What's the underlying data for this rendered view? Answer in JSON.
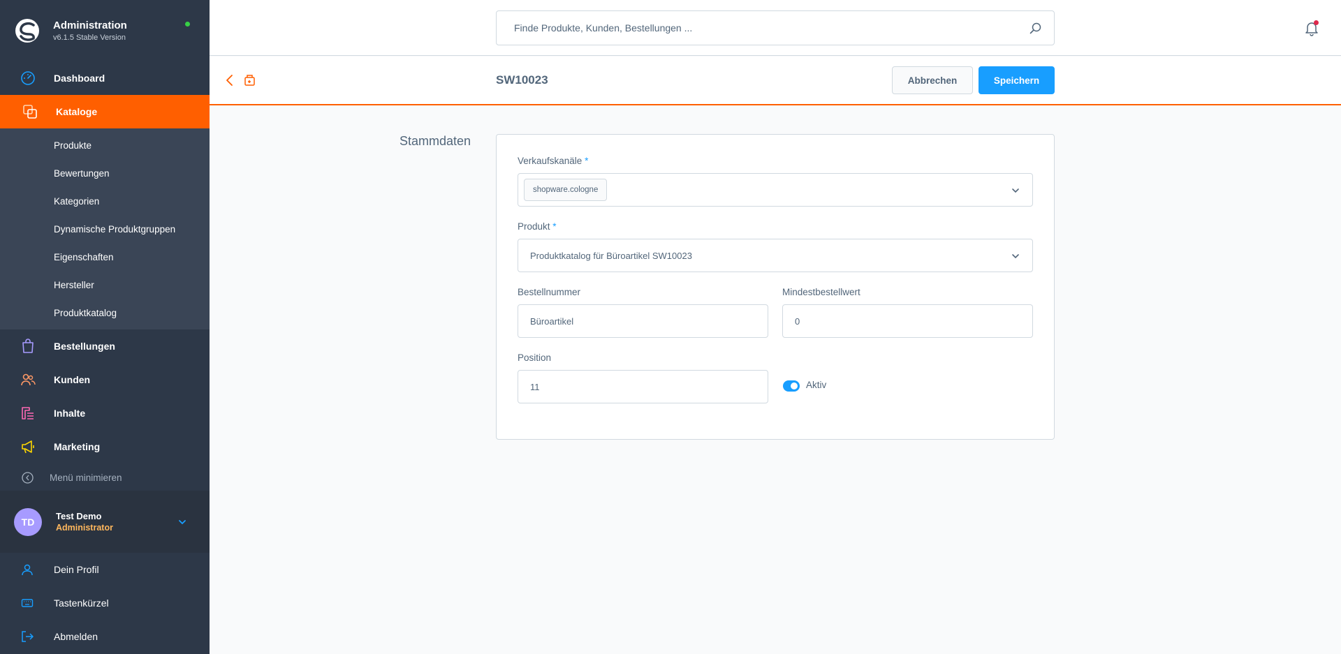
{
  "brand": {
    "title": "Administration",
    "version": "v6.1.5 Stable Version"
  },
  "sidebar": {
    "items": [
      {
        "label": "Dashboard",
        "icon": "dashboard-icon"
      },
      {
        "label": "Kataloge",
        "icon": "catalog-icon",
        "active": true
      },
      {
        "label": "Bestellungen",
        "icon": "orders-icon"
      },
      {
        "label": "Kunden",
        "icon": "customers-icon"
      },
      {
        "label": "Inhalte",
        "icon": "content-icon"
      },
      {
        "label": "Marketing",
        "icon": "marketing-icon"
      }
    ],
    "subitems": [
      "Produkte",
      "Bewertungen",
      "Kategorien",
      "Dynamische Produktgruppen",
      "Eigenschaften",
      "Hersteller",
      "Produktkatalog"
    ],
    "minimize_label": "Menü minimieren"
  },
  "user": {
    "initials": "TD",
    "name": "Test Demo",
    "role": "Administrator"
  },
  "account_nav": [
    "Dein Profil",
    "Tastenkürzel",
    "Abmelden"
  ],
  "search": {
    "placeholder": "Finde Produkte, Kunden, Bestellungen ..."
  },
  "smartbar": {
    "title": "SW10023",
    "cancel_label": "Abbrechen",
    "save_label": "Speichern"
  },
  "form": {
    "section_title": "Stammdaten",
    "sales_channels": {
      "label": "Verkaufskanäle",
      "required": "*",
      "tags": [
        "shopware.cologne"
      ]
    },
    "product": {
      "label": "Produkt",
      "required": "*",
      "value": "Produktkatalog für Büroartikel SW10023"
    },
    "order_number": {
      "label": "Bestellnummer",
      "value": "Büroartikel"
    },
    "min_order_value": {
      "label": "Mindestbestellwert",
      "value": "0"
    },
    "position": {
      "label": "Position",
      "value": "11"
    },
    "active": {
      "label": "Aktiv",
      "checked": true
    }
  },
  "colors": {
    "sidebar_bg": "#2d3848",
    "accent": "#ff5f00",
    "primary": "#189eff"
  }
}
